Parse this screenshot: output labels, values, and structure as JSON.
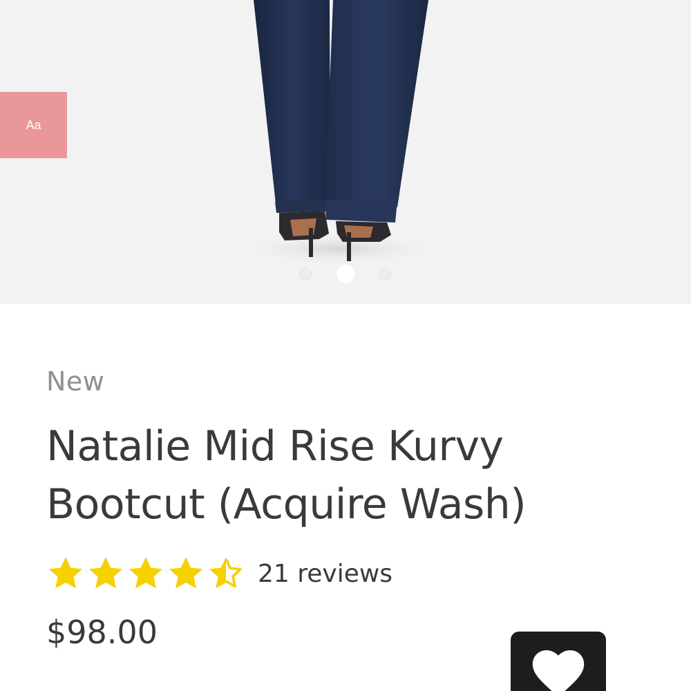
{
  "font_size_control": {
    "label": "Aa"
  },
  "carousel": {
    "slide_count": 3,
    "active_index": 1
  },
  "product": {
    "badge": "New",
    "title_line1": "Natalie Mid Rise Kurvy",
    "title_line2": "Bootcut (Acquire Wash)",
    "rating": 4.5,
    "rating_max": 5,
    "reviews_label": "21 reviews",
    "price": "$98.00"
  },
  "icons": {
    "star": "star-icon",
    "half_star": "star-half-icon",
    "wishlist": "heart-icon"
  },
  "colors": {
    "accent_pink": "#e9979a",
    "star_gold": "#f7d000",
    "text_dark": "#3a3a3a",
    "text_muted": "#8f8f8f",
    "wishlist_bg": "#1f1c1c"
  }
}
